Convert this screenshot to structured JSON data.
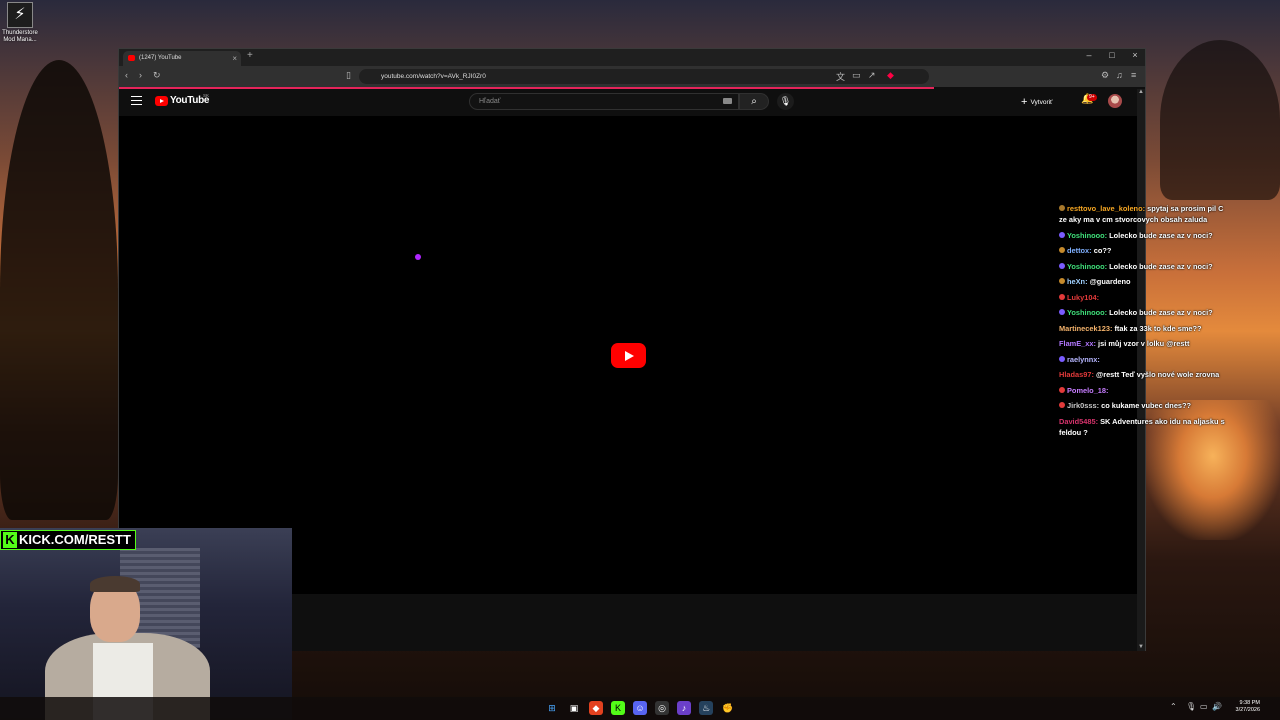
{
  "desktop": {
    "icon_label": "Thunderstore Mod Mana..."
  },
  "browser": {
    "tab_title": "(1247) YouTube",
    "url": "youtube.com/watch?v=AVk_RJI0Zr0"
  },
  "youtube": {
    "logo_text": "YouTube",
    "country": "SK",
    "search_placeholder": "Hľadať",
    "create_label": "Vytvoriť",
    "notification_badge": "9+"
  },
  "chat": {
    "messages": [
      {
        "user": "resttovo_lave_koleno:",
        "text": "spytaj sa prosim pil C ze aky ma v cm stvorcovych obsah zaluda",
        "color": "#f5a623",
        "badge": "#a8792c"
      },
      {
        "user": "Yoshinooo:",
        "text": "Lolecko bude zase az v noci?",
        "color": "#3fe07a",
        "badge": "#7a5cff"
      },
      {
        "user": "dettox:",
        "text": "co??",
        "color": "#7fb0ff",
        "badge": "#c58a2c"
      },
      {
        "user": "Yoshinooo:",
        "text": "Lolecko bude zase az v noci?",
        "color": "#3fe07a",
        "badge": "#7a5cff"
      },
      {
        "user": "heXn:",
        "text": "@guardeno",
        "color": "#9fd0ff",
        "badge": "#c58a2c"
      },
      {
        "user": "Luky104:",
        "text": "",
        "color": "#e23a3a",
        "badge": "#e23a3a"
      },
      {
        "user": "Yoshinooo:",
        "text": "Lolecko bude zase az v noci?",
        "color": "#3fe07a",
        "badge": "#7a5cff"
      },
      {
        "user": "Martinecek123:",
        "text": "ftak za 33k to kde sme??",
        "color": "#f3b26b",
        "badge": ""
      },
      {
        "user": "FlamE_xx:",
        "text": "jsi můj vzor v lolku @restt",
        "color": "#b278ff",
        "badge": ""
      },
      {
        "user": "raelynnx:",
        "text": "",
        "color": "#b6b6ff",
        "badge": "#7a5cff"
      },
      {
        "user": "Hladas97:",
        "text": "@restt Teď vyšlo nové wole zrovna",
        "color": "#e23a3a",
        "badge": ""
      },
      {
        "user": "Pomelo_18:",
        "text": "",
        "color": "#c77dff",
        "badge": "#e23a3a"
      },
      {
        "user": "Jirk0sss:",
        "text": "co kukame vubec dnes??",
        "color": "#c7c7c7",
        "badge": "#e23a3a"
      },
      {
        "user": "David5485:",
        "text": "SK Adventures ako idu na aljasku s feldou ?",
        "color": "#d6336c",
        "badge": ""
      }
    ]
  },
  "webcam": {
    "overlay_text": "KICK.COM/RESTT",
    "overlay_k": "K"
  },
  "taskbar": {
    "time": "9:38 PM",
    "date": "3/27/2026"
  }
}
